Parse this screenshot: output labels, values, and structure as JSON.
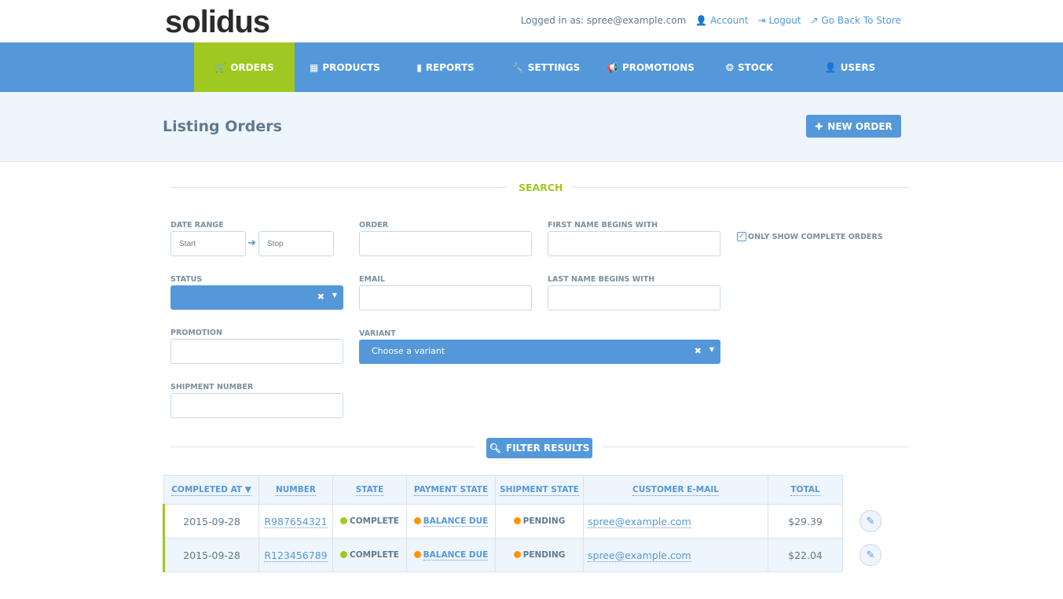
{
  "brand": "solidus",
  "top": {
    "logged_in": "Logged in as: spree@example.com",
    "account": "Account",
    "logout": "Logout",
    "store": "Go Back To Store"
  },
  "nav": [
    {
      "label": "ORDERS",
      "icon": "🛒"
    },
    {
      "label": "PRODUCTS",
      "icon": "▦"
    },
    {
      "label": "REPORTS",
      "icon": "▮"
    },
    {
      "label": "SETTINGS",
      "icon": "🔧"
    },
    {
      "label": "PROMOTIONS",
      "icon": "📢"
    },
    {
      "label": "STOCK",
      "icon": "❂"
    },
    {
      "label": "USERS",
      "icon": "👤"
    }
  ],
  "page": {
    "title": "Listing Orders",
    "new_order": "NEW ORDER"
  },
  "search": {
    "heading": "SEARCH",
    "date_range": "DATE RANGE",
    "start_ph": "Start",
    "stop_ph": "Stop",
    "order": "ORDER",
    "first_name": "FIRST NAME BEGINS WITH",
    "only_complete": "ONLY SHOW COMPLETE ORDERS",
    "status": "STATUS",
    "email": "EMAIL",
    "last_name": "LAST NAME BEGINS WITH",
    "promotion": "PROMOTION",
    "variant": "VARIANT",
    "variant_ph": "Choose a variant",
    "shipment": "SHIPMENT NUMBER",
    "filter": "FILTER RESULTS"
  },
  "table": {
    "headers": [
      "COMPLETED AT ▼",
      "NUMBER",
      "STATE",
      "PAYMENT STATE",
      "SHIPMENT STATE",
      "CUSTOMER E-MAIL",
      "TOTAL"
    ],
    "rows": [
      {
        "date": "2015-09-28",
        "number": "R987654321",
        "state": "COMPLETE",
        "payment": "BALANCE DUE",
        "shipment": "PENDING",
        "email": "spree@example.com",
        "total": "$29.39"
      },
      {
        "date": "2015-09-28",
        "number": "R123456789",
        "state": "COMPLETE",
        "payment": "BALANCE DUE",
        "shipment": "PENDING",
        "email": "spree@example.com",
        "total": "$22.04"
      }
    ]
  },
  "colors": {
    "primary": "#5498da",
    "green": "#9fc820",
    "orange": "#ff9300"
  }
}
